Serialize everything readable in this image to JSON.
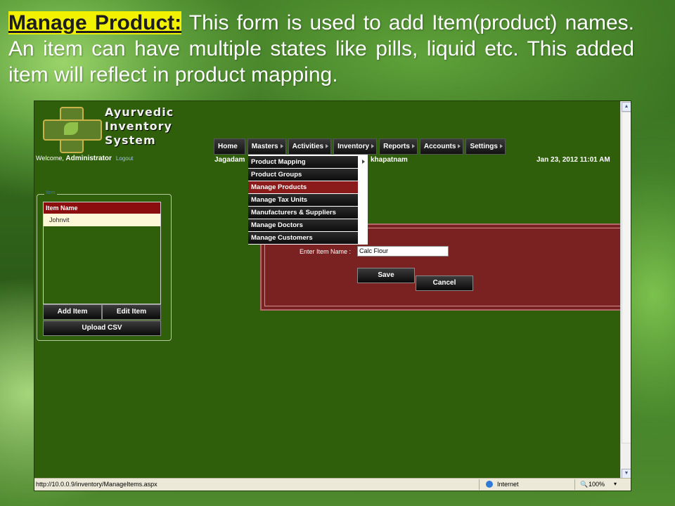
{
  "slide": {
    "heading": "Manage Product:",
    "description": " This form is used to add Item(product) names. An item can have multiple states like pills, liquid etc. This added item will reflect in product mapping."
  },
  "app": {
    "logo_lines": [
      "Ayurvedic",
      "Inventory",
      "System"
    ],
    "welcome_prefix": "Welcome, ",
    "user": "Administrator",
    "logout": "Logout",
    "menu": [
      "Home",
      "Masters",
      "Activities",
      "Inventory",
      "Reports",
      "Accounts",
      "Settings"
    ],
    "location_left": "Jagadam",
    "location_right": "khapatnam",
    "datetime": "Jan 23, 2012 11:01 AM",
    "masters_dropdown": {
      "items": [
        "Product Mapping",
        "Product Groups",
        "Manage Products",
        "Manage Tax Units",
        "Manufacturers & Suppliers",
        "Manage Doctors",
        "Manage Customers"
      ],
      "active": "Manage Products"
    },
    "items_panel": {
      "legend": "Item",
      "column_header": "Item Name",
      "rows": [
        "Johnvit"
      ],
      "add_button": "Add Item",
      "edit_button": "Edit Item",
      "upload_button": "Upload CSV"
    },
    "form": {
      "label": "Enter Item Name :",
      "value": "Calc Flour",
      "save": "Save",
      "cancel": "Cancel"
    }
  },
  "browser_status": {
    "url": "http://10.0.0.9/inventory/ManageItems.aspx",
    "zone": "Internet",
    "zoom": "100%"
  },
  "colors": {
    "app_background": "#2f5f0b",
    "list_header": "#8b0d0d",
    "form_panel": "#7a2222",
    "active_menu": "#8b1b1b",
    "heading_highlight": "#f2f200"
  }
}
